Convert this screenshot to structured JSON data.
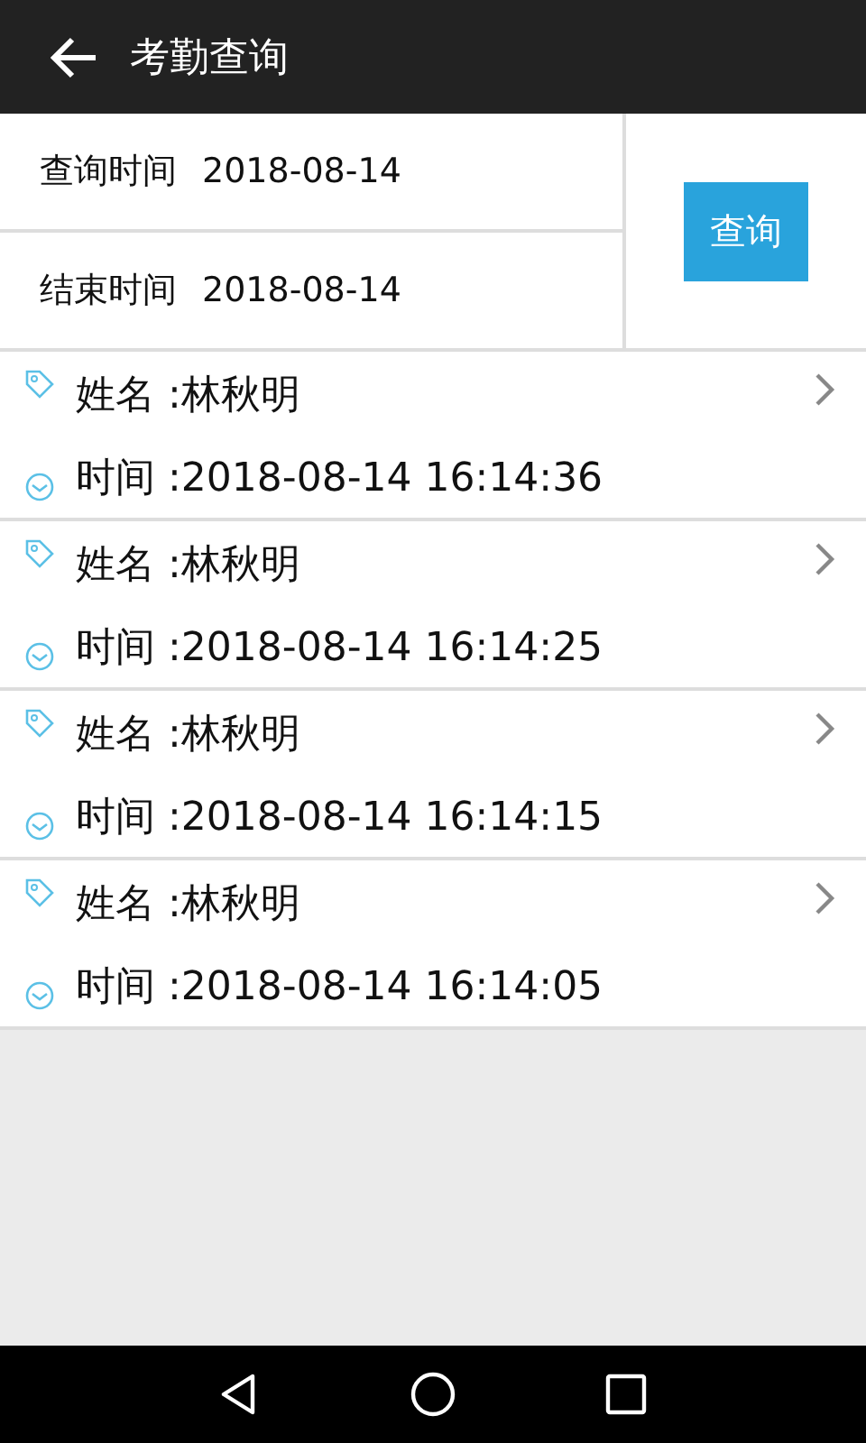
{
  "header": {
    "title": "考勤查询"
  },
  "query": {
    "fields": [
      {
        "label": "查询时间",
        "value": "2018-08-14"
      },
      {
        "label": "结束时间",
        "value": "2018-08-14"
      }
    ],
    "button": "查询"
  },
  "records": [
    {
      "name": "姓名 :林秋明",
      "time": "时间 :2018-08-14 16:14:36"
    },
    {
      "name": "姓名 :林秋明",
      "time": "时间 :2018-08-14 16:14:25"
    },
    {
      "name": "姓名 :林秋明",
      "time": "时间 :2018-08-14 16:14:15"
    },
    {
      "name": "姓名 :林秋明",
      "time": "时间 :2018-08-14 16:14:05"
    }
  ]
}
